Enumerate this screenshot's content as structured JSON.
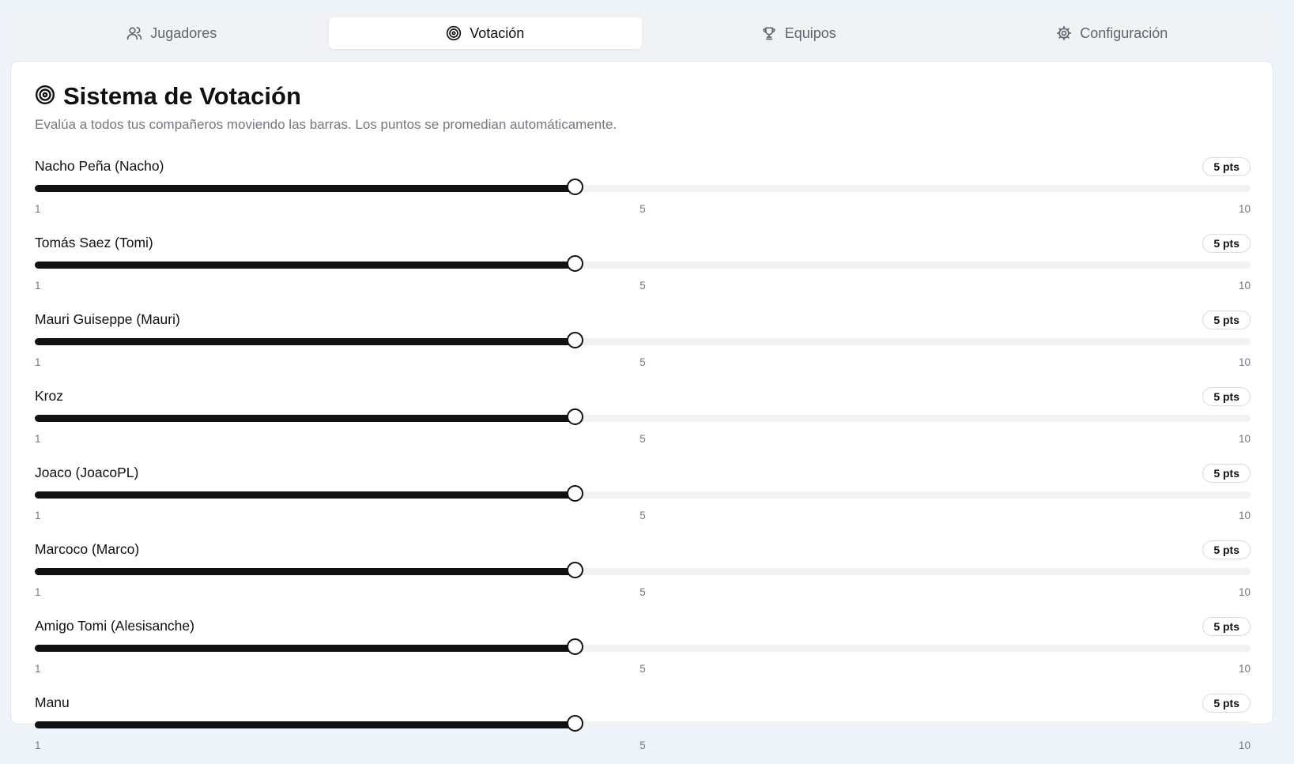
{
  "tabs": [
    {
      "label": "Jugadores",
      "icon": "users-icon",
      "active": false
    },
    {
      "label": "Votación",
      "icon": "target-icon",
      "active": true
    },
    {
      "label": "Equipos",
      "icon": "trophy-icon",
      "active": false
    },
    {
      "label": "Configuración",
      "icon": "gear-icon",
      "active": false
    }
  ],
  "page": {
    "title": "Sistema de Votación",
    "title_icon": "target-icon",
    "subtitle": "Evalúa a todos tus compañeros moviendo las barras. Los puntos se promedian automáticamente."
  },
  "slider_scale": {
    "min": 1,
    "max": 10,
    "min_label": "1",
    "mid_label": "5",
    "max_label": "10"
  },
  "players": [
    {
      "name": "Nacho Peña (Nacho)",
      "value": 5,
      "points_label": "5 pts"
    },
    {
      "name": "Tomás Saez (Tomi)",
      "value": 5,
      "points_label": "5 pts"
    },
    {
      "name": "Mauri Guiseppe (Mauri)",
      "value": 5,
      "points_label": "5 pts"
    },
    {
      "name": "Kroz",
      "value": 5,
      "points_label": "5 pts"
    },
    {
      "name": "Joaco (JoacoPL)",
      "value": 5,
      "points_label": "5 pts"
    },
    {
      "name": "Marcoco (Marco)",
      "value": 5,
      "points_label": "5 pts"
    },
    {
      "name": "Amigo Tomi (Alesisanche)",
      "value": 5,
      "points_label": "5 pts"
    },
    {
      "name": "Manu",
      "value": 5,
      "points_label": "5 pts"
    }
  ],
  "colors": {
    "accent": "#111111",
    "track": "#f1f2f4",
    "muted_text": "#737780",
    "background": "#eef4fa"
  }
}
